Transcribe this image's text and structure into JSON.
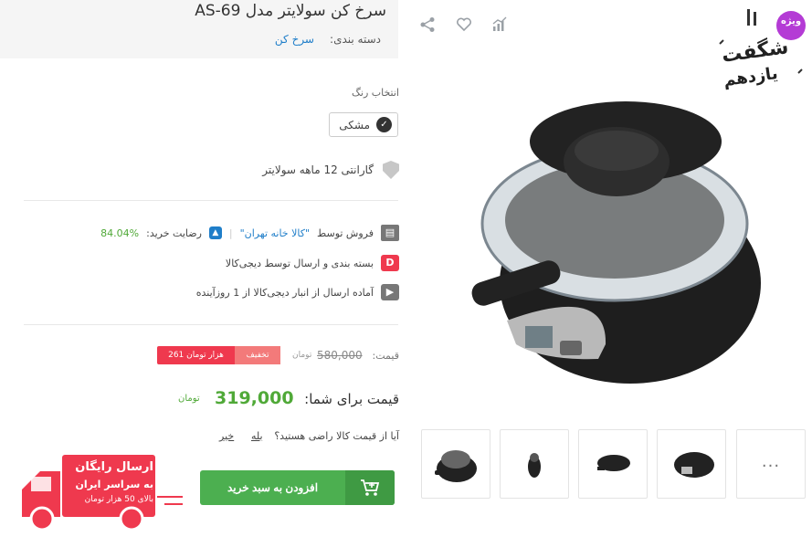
{
  "product": {
    "title": "سرخ کن سولایتر مدل AS-69",
    "category_label": "دسته بندی:",
    "category_value": "سرخ کن"
  },
  "color": {
    "label": "انتخاب رنگ",
    "selected": "مشکی",
    "check_icon": "check-icon"
  },
  "warranty": {
    "text": "گارانتی 12 ماهه سولایتر",
    "icon": "shield-icon"
  },
  "seller": {
    "prefix": "فروش توسط",
    "name": "\"کالا خانه تهران\"",
    "separator": "|",
    "satisfaction_label": "رضایت خرید:",
    "satisfaction_value": "84.04%",
    "icon": "store-icon"
  },
  "packaging": {
    "text": "بسته بندی و ارسال توسط دیجی‌کالا",
    "icon": "digikala-logo"
  },
  "shipping": {
    "text": "آماده ارسال از انبار دیجی‌کالا از 1 روزآینده",
    "icon": "truck-icon"
  },
  "price": {
    "label": "قیمت:",
    "old_value": "580,000",
    "old_unit": "تومان",
    "discount_label": "تخفیف",
    "discount_value": "261 هزار تومان",
    "final_label": "قیمت برای شما:",
    "final_value": "319,000",
    "final_unit": "تومان"
  },
  "feedback": {
    "question": "آیا از قیمت کالا راضی هستید؟",
    "yes": "بله",
    "no": "خیر"
  },
  "cart": {
    "label": "افزودن به سبد خرید",
    "icon": "add-to-cart-icon"
  },
  "promo_badge": {
    "line1": "شگفت",
    "line2": "یازدهم",
    "tag": "ویژه"
  },
  "free_shipping": {
    "line1": "ارسال رایگان",
    "line2": "به سراسر ایران",
    "line3": "بالای 50 هزار تومان"
  },
  "thumbnails": {
    "more": "..."
  },
  "colors": {
    "accent_green": "#4caf50",
    "discount_red": "#ef394e",
    "link_blue": "#1f7ec9"
  }
}
